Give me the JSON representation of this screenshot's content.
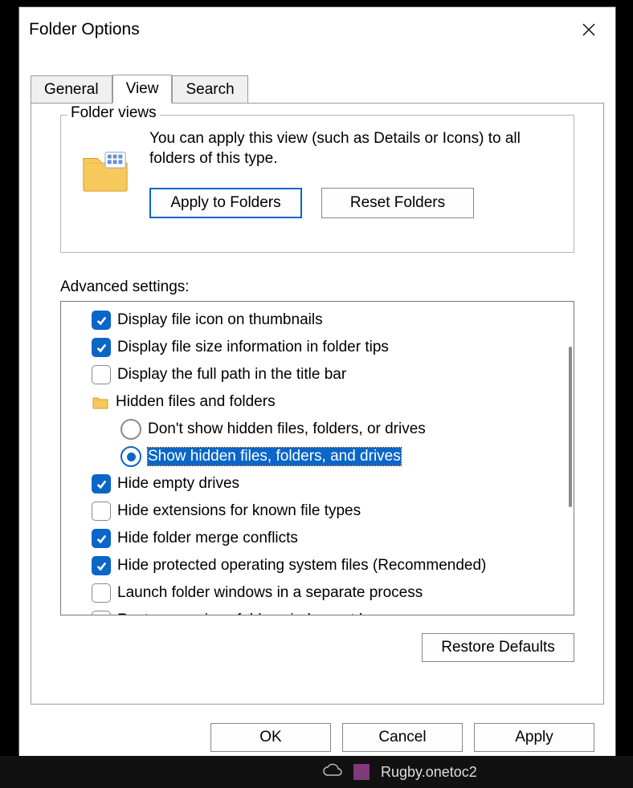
{
  "dialog": {
    "title": "Folder Options"
  },
  "tabs": {
    "general": "General",
    "view": "View",
    "search": "Search"
  },
  "folder_views": {
    "legend": "Folder views",
    "text": "You can apply this view (such as Details or Icons) to all folders of this type.",
    "apply_btn": "Apply to Folders",
    "reset_btn": "Reset Folders"
  },
  "advanced": {
    "label": "Advanced settings:",
    "items": [
      {
        "type": "checkbox",
        "checked": true,
        "indent": 1,
        "text": "Display file icon on thumbnails"
      },
      {
        "type": "checkbox",
        "checked": true,
        "indent": 1,
        "text": "Display file size information in folder tips"
      },
      {
        "type": "checkbox",
        "checked": false,
        "indent": 1,
        "text": "Display the full path in the title bar"
      },
      {
        "type": "folder",
        "indent": 1,
        "text": "Hidden files and folders"
      },
      {
        "type": "radio",
        "checked": false,
        "indent": 2,
        "text": "Don't show hidden files, folders, or drives"
      },
      {
        "type": "radio",
        "checked": true,
        "indent": 2,
        "selected": true,
        "text": "Show hidden files, folders, and drives"
      },
      {
        "type": "checkbox",
        "checked": true,
        "indent": 1,
        "text": "Hide empty drives"
      },
      {
        "type": "checkbox",
        "checked": false,
        "indent": 1,
        "text": "Hide extensions for known file types"
      },
      {
        "type": "checkbox",
        "checked": true,
        "indent": 1,
        "text": "Hide folder merge conflicts"
      },
      {
        "type": "checkbox",
        "checked": true,
        "indent": 1,
        "text": "Hide protected operating system files (Recommended)"
      },
      {
        "type": "checkbox",
        "checked": false,
        "indent": 1,
        "text": "Launch folder windows in a separate process"
      },
      {
        "type": "checkbox",
        "checked": false,
        "indent": 1,
        "text": "Restore previous folder windows at logon"
      }
    ]
  },
  "buttons": {
    "restore_defaults": "Restore Defaults",
    "ok": "OK",
    "cancel": "Cancel",
    "apply": "Apply"
  },
  "taskbar": {
    "file": "Rugby.onetoc2"
  }
}
